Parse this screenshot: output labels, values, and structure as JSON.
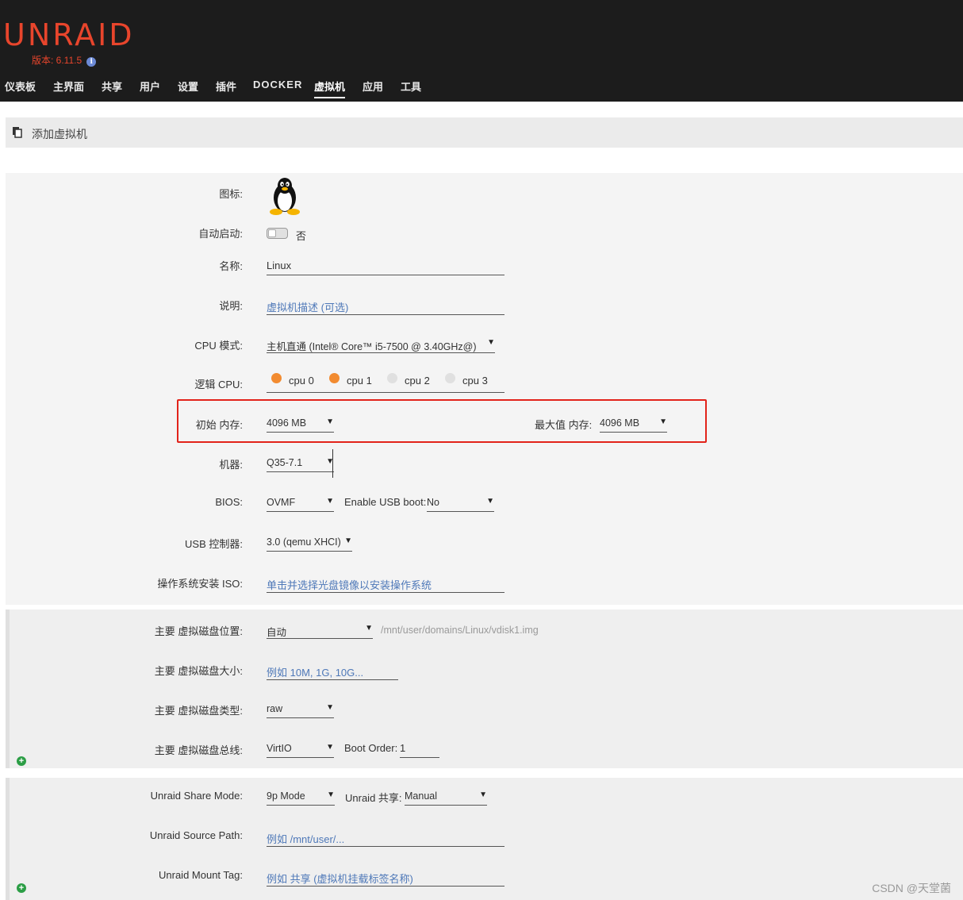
{
  "header": {
    "logo": "UNRAID",
    "version": "版本: 6.11.5",
    "info_icon": "info-icon",
    "nav": [
      "仪表板",
      "主界面",
      "共享",
      "用户",
      "设置",
      "插件",
      "DOCKER",
      "虚拟机",
      "应用",
      "工具"
    ],
    "active_nav": "虚拟机"
  },
  "titlebar": {
    "title": "添加虚拟机",
    "icon": "document-copy-icon"
  },
  "form": {
    "icon_label": "图标:",
    "autostart_label": "自动启动:",
    "autostart_value": "否",
    "name_label": "名称:",
    "name_value": "Linux",
    "desc_label": "说明:",
    "desc_placeholder": "虚拟机描述 (可选)",
    "cpu_mode_label": "CPU 模式:",
    "cpu_mode_value": "主机直通 (Intel® Core™ i5-7500 @ 3.40GHz@)",
    "logical_cpu_label": "逻辑 CPU:",
    "cpus": [
      {
        "label": "cpu 0",
        "checked": true
      },
      {
        "label": "cpu 1",
        "checked": true
      },
      {
        "label": "cpu 2",
        "checked": false
      },
      {
        "label": "cpu 3",
        "checked": false
      }
    ],
    "init_mem_label": "初始 内存:",
    "init_mem_value": "4096 MB",
    "max_mem_label": "最大值 内存:",
    "max_mem_value": "4096 MB",
    "machine_label": "机器:",
    "machine_value": "Q35-7.1",
    "bios_label": "BIOS:",
    "bios_value": "OVMF",
    "usb_boot_label": "Enable USB boot:",
    "usb_boot_value": "No",
    "usb_ctrl_label": "USB 控制器:",
    "usb_ctrl_value": "3.0 (qemu XHCI)",
    "iso_label": "操作系统安装 ISO:",
    "iso_placeholder": "单击并选择光盘镜像以安装操作系统"
  },
  "disk": {
    "location_label": "主要 虚拟磁盘位置:",
    "location_value": "自动",
    "location_path": "/mnt/user/domains/Linux/vdisk1.img",
    "size_label": "主要 虚拟磁盘大小:",
    "size_placeholder": "例如 10M, 1G, 10G...",
    "type_label": "主要 虚拟磁盘类型:",
    "type_value": "raw",
    "bus_label": "主要 虚拟磁盘总线:",
    "bus_value": "VirtIO",
    "boot_order_label": "Boot Order:",
    "boot_order_value": "1"
  },
  "share": {
    "mode_label": "Unraid Share Mode:",
    "mode_value": "9p Mode",
    "share_label": "Unraid 共享:",
    "share_value": "Manual",
    "source_label": "Unraid Source Path:",
    "source_placeholder": "例如 /mnt/user/...",
    "mount_label": "Unraid Mount Tag:",
    "mount_placeholder": "例如 共享 (虚拟机挂载标签名称)"
  },
  "watermark": "CSDN @天堂菌",
  "colors": {
    "brand": "#e8452c",
    "header_bg": "#1c1c1c",
    "cpu_on": "#f28b30",
    "highlight_box": "#e2231a",
    "link": "#4e78b8"
  }
}
